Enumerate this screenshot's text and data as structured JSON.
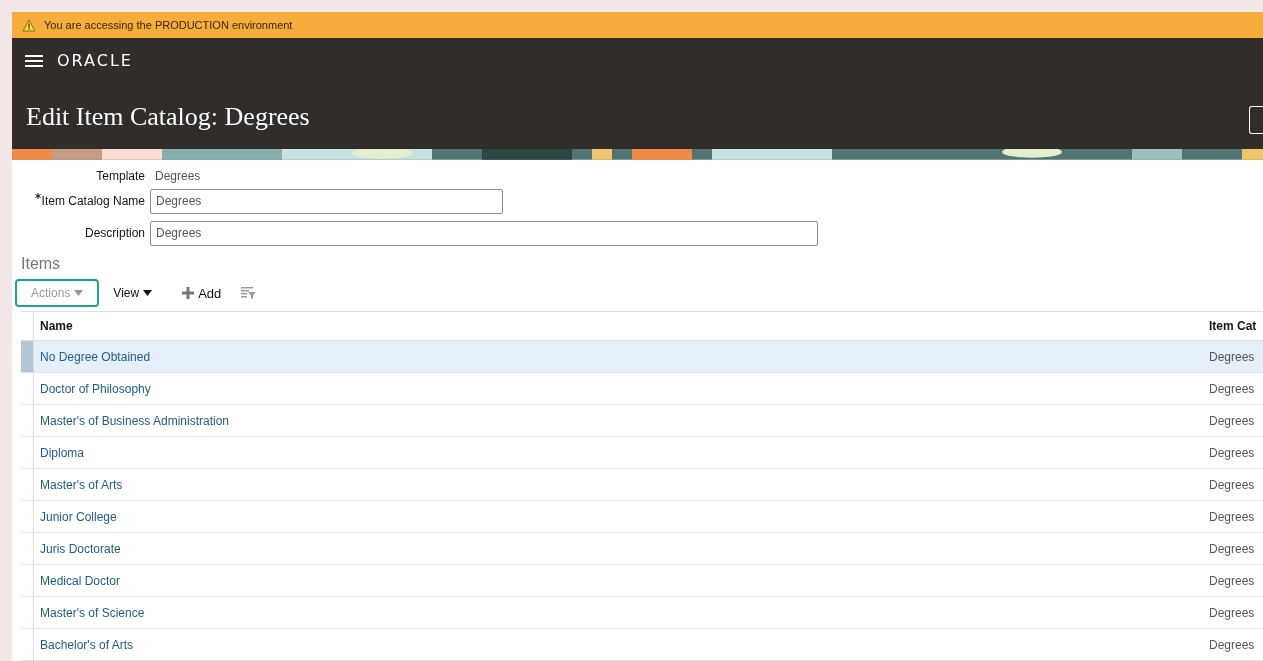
{
  "warning_bar": {
    "text": "You are accessing the PRODUCTION environment"
  },
  "header": {
    "logo": "ORACLE",
    "title": "Edit Item Catalog: Degrees"
  },
  "form": {
    "template": {
      "label": "Template",
      "value": "Degrees"
    },
    "fields": [
      {
        "label": "Item Catalog Name",
        "required": true,
        "value": "Degrees"
      },
      {
        "label": "Description",
        "required": false,
        "value": "Degrees"
      }
    ]
  },
  "items": {
    "title": "Items",
    "toolbar": [
      {
        "kind": "menu",
        "label": "Actions",
        "disabled": true,
        "focused": true
      },
      {
        "kind": "menu",
        "label": "View",
        "disabled": false,
        "focused": false
      },
      {
        "kind": "add",
        "label": "Add",
        "disabled": false,
        "focused": false
      },
      {
        "kind": "filter",
        "disabled": true,
        "focused": false
      }
    ],
    "columns": [
      "Name",
      "Item Cat"
    ],
    "rows": [
      {
        "name": "No Degree Obtained",
        "catalog": "Degrees",
        "selected": true
      },
      {
        "name": "Doctor of Philosophy",
        "catalog": "Degrees",
        "selected": false
      },
      {
        "name": "Master's of Business Administration",
        "catalog": "Degrees",
        "selected": false
      },
      {
        "name": "Diploma",
        "catalog": "Degrees",
        "selected": false
      },
      {
        "name": "Master's of Arts",
        "catalog": "Degrees",
        "selected": false
      },
      {
        "name": "Junior College",
        "catalog": "Degrees",
        "selected": false
      },
      {
        "name": "Juris Doctorate",
        "catalog": "Degrees",
        "selected": false
      },
      {
        "name": "Medical Doctor",
        "catalog": "Degrees",
        "selected": false
      },
      {
        "name": "Master's of Science",
        "catalog": "Degrees",
        "selected": false
      },
      {
        "name": "Bachelor's of Arts",
        "catalog": "Degrees",
        "selected": false
      }
    ]
  }
}
